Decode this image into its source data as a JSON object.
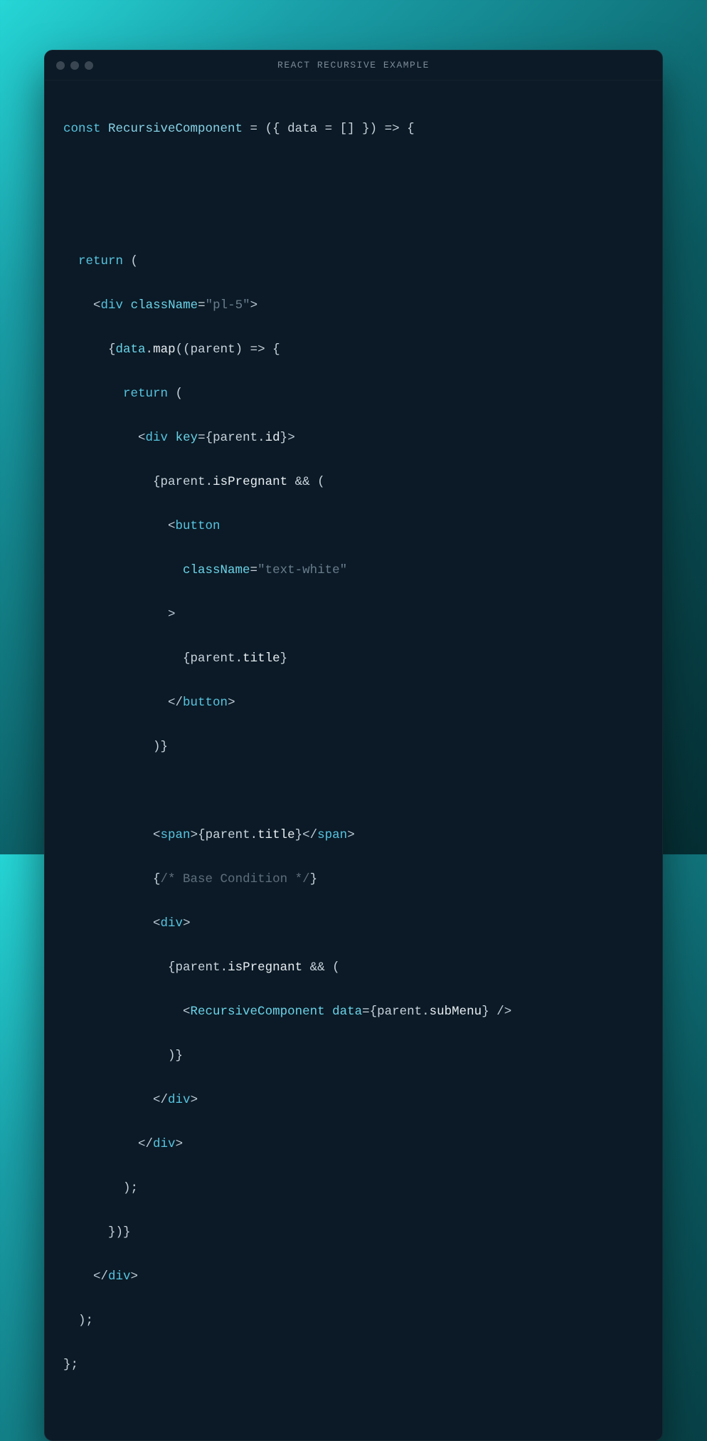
{
  "window": {
    "title": "REACT RECURSIVE EXAMPLE"
  },
  "code": {
    "l1": {
      "const": "const ",
      "name": "RecursiveComponent",
      "eq": " = ",
      "open": "(",
      "brace1": "{ ",
      "param": "data",
      "def": " = [] ",
      "brace2": "}",
      "close": ") ",
      "arrow": "=>",
      "ob": " {"
    },
    "l2": {
      "return": "return",
      "open": " ("
    },
    "l3": {
      "lt": "<",
      "tag": "div",
      "sp": " ",
      "attr": "className",
      "eq": "=",
      "str": "\"pl-5\"",
      "gt": ">"
    },
    "l4": {
      "ob": "{",
      "obj": "data",
      "dot": ".",
      "map": "map",
      "open": "((",
      "arg": "parent",
      "close": ") ",
      "arrow": "=>",
      "cb": " {"
    },
    "l5": {
      "return": "return",
      "open": " ("
    },
    "l6": {
      "lt": "<",
      "tag": "div",
      "sp": " ",
      "attr": "key",
      "eq": "=",
      "ob": "{",
      "obj": "parent",
      "dot": ".",
      "prop": "id",
      "cb": "}",
      "gt": ">"
    },
    "l7": {
      "ob": "{",
      "obj": "parent",
      "dot": ".",
      "prop": "isPregnant",
      "amp": " && ",
      "open": "("
    },
    "l8": {
      "lt": "<",
      "tag": "button"
    },
    "l9": {
      "attr": "className",
      "eq": "=",
      "str": "\"text-white\""
    },
    "l10": {
      "gt": ">"
    },
    "l11": {
      "ob": "{",
      "obj": "parent",
      "dot": ".",
      "prop": "title",
      "cb": "}"
    },
    "l12": {
      "lt": "</",
      "tag": "button",
      "gt": ">"
    },
    "l13": {
      "close": ")",
      "cb": "}"
    },
    "l14": {
      "lt": "<",
      "tag": "span",
      "gt": ">",
      "ob": "{",
      "obj": "parent",
      "dot": ".",
      "prop": "title",
      "cb": "}",
      "lt2": "</",
      "tag2": "span",
      "gt2": ">"
    },
    "l15": {
      "ob": "{",
      "cmt": "/* Base Condition */",
      "cb": "}"
    },
    "l16": {
      "lt": "<",
      "tag": "div",
      "gt": ">"
    },
    "l17": {
      "ob": "{",
      "obj": "parent",
      "dot": ".",
      "prop": "isPregnant",
      "amp": " && ",
      "open": "("
    },
    "l18": {
      "lt": "<",
      "comp": "RecursiveComponent",
      "sp": " ",
      "attr": "data",
      "eq": "=",
      "ob": "{",
      "obj": "parent",
      "dot": ".",
      "prop": "subMenu",
      "cb": "}",
      "sc": " /",
      "gt": ">"
    },
    "l19": {
      "close": ")",
      "cb": "}"
    },
    "l20": {
      "lt": "</",
      "tag": "div",
      "gt": ">"
    },
    "l21": {
      "lt": "</",
      "tag": "div",
      "gt": ">"
    },
    "l22": {
      "close": ");"
    },
    "l23": {
      "close": "})",
      "cb": "}"
    },
    "l24": {
      "lt": "</",
      "tag": "div",
      "gt": ">"
    },
    "l25": {
      "close": ");"
    },
    "l26": {
      "close": "};"
    }
  }
}
